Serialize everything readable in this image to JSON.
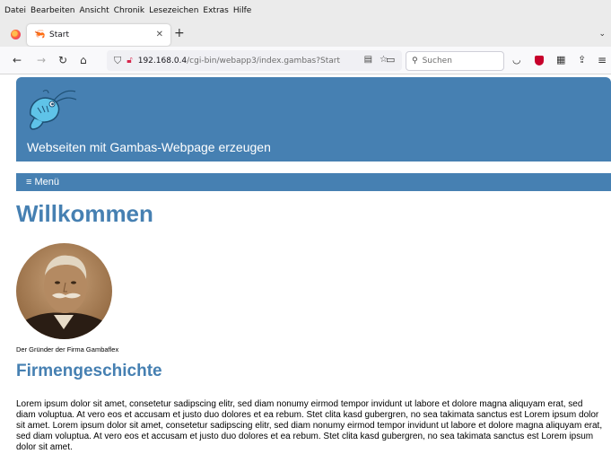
{
  "menubar": {
    "items": [
      "Datei",
      "Bearbeiten",
      "Ansicht",
      "Chronik",
      "Lesezeichen",
      "Extras",
      "Hilfe"
    ]
  },
  "tabs": {
    "active_title": "Start",
    "close_glyph": "✕",
    "new_tab_glyph": "+",
    "list_glyph": "⌄"
  },
  "nav": {
    "back_glyph": "←",
    "forward_glyph": "→",
    "reload_glyph": "↻",
    "home_glyph": "⌂",
    "url_host": "192.168.0.4",
    "url_path": "/cgi-bin/webapp3/index.gambas?Start",
    "search_placeholder": "Suchen",
    "menu_glyph": "≡"
  },
  "page": {
    "header_title": "Webseiten mit Gambas-Webpage erzeugen",
    "menu_label": "≡ Menü",
    "heading": "Willkommen",
    "caption": "Der Gründer der Firma Gambaflex",
    "subheading": "Firmengeschichte",
    "paragraph": "Lorem ipsum dolor sit amet, consetetur sadipscing elitr, sed diam nonumy eirmod tempor invidunt ut labore et dolore magna aliquyam erat, sed diam voluptua. At vero eos et accusam et justo duo dolores et ea rebum. Stet clita kasd gubergren, no sea takimata sanctus est Lorem ipsum dolor sit amet. Lorem ipsum dolor sit amet, consetetur sadipscing elitr, sed diam nonumy eirmod tempor invidunt ut labore et dolore magna aliquyam erat, sed diam voluptua. At vero eos et accusam et justo duo dolores et ea rebum. Stet clita kasd gubergren, no sea takimata sanctus est Lorem ipsum dolor sit amet."
  },
  "colors": {
    "brand_blue": "#4680b2",
    "chrome_bg": "#ebebeb"
  }
}
